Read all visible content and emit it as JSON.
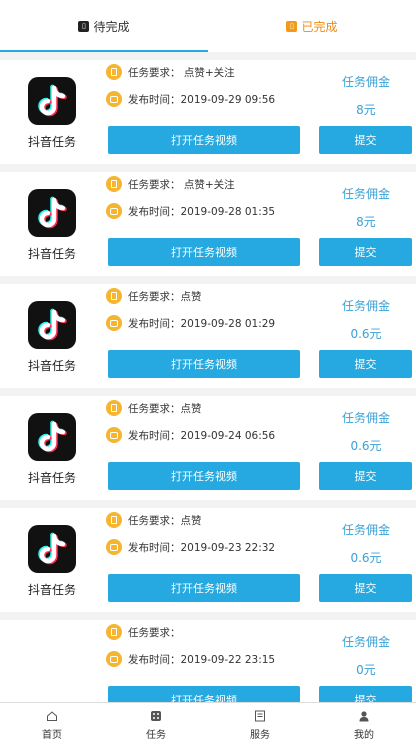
{
  "tabs": [
    {
      "label": "待完成",
      "icon": "pending-icon",
      "active": true
    },
    {
      "label": "已完成",
      "icon": "done-icon",
      "active": false
    }
  ],
  "colors": {
    "accent": "#26a9e0",
    "orange": "#f08a15",
    "commission": "#3aa0d6",
    "badge": "#f5b52e"
  },
  "tasks": [
    {
      "app": "抖音任务",
      "requirement": "任务要求：  点赞+关注",
      "published": "发布时间：2019-09-29 09:56",
      "commission_label": "任务佣金",
      "commission": "8元",
      "open_label": "打开任务视频",
      "submit_label": "提交"
    },
    {
      "app": "抖音任务",
      "requirement": "任务要求：  点赞+关注",
      "published": "发布时间：2019-09-28 01:35",
      "commission_label": "任务佣金",
      "commission": "8元",
      "open_label": "打开任务视频",
      "submit_label": "提交"
    },
    {
      "app": "抖音任务",
      "requirement": "任务要求：点赞",
      "published": "发布时间：2019-09-28 01:29",
      "commission_label": "任务佣金",
      "commission": "0.6元",
      "open_label": "打开任务视频",
      "submit_label": "提交"
    },
    {
      "app": "抖音任务",
      "requirement": "任务要求：点赞",
      "published": "发布时间：2019-09-24 06:56",
      "commission_label": "任务佣金",
      "commission": "0.6元",
      "open_label": "打开任务视频",
      "submit_label": "提交"
    },
    {
      "app": "抖音任务",
      "requirement": "任务要求：点赞",
      "published": "发布时间：2019-09-23 22:32",
      "commission_label": "任务佣金",
      "commission": "0.6元",
      "open_label": "打开任务视频",
      "submit_label": "提交"
    },
    {
      "app": "",
      "requirement": "任务要求：",
      "published": "发布时间：2019-09-22 23:15",
      "commission_label": "任务佣金",
      "commission": "0元",
      "open_label": "打开任务视频",
      "submit_label": "提交"
    }
  ],
  "nav": [
    {
      "label": "首页",
      "icon": "home-icon"
    },
    {
      "label": "任务",
      "icon": "task-icon"
    },
    {
      "label": "服务",
      "icon": "service-icon"
    },
    {
      "label": "我的",
      "icon": "profile-icon"
    }
  ]
}
